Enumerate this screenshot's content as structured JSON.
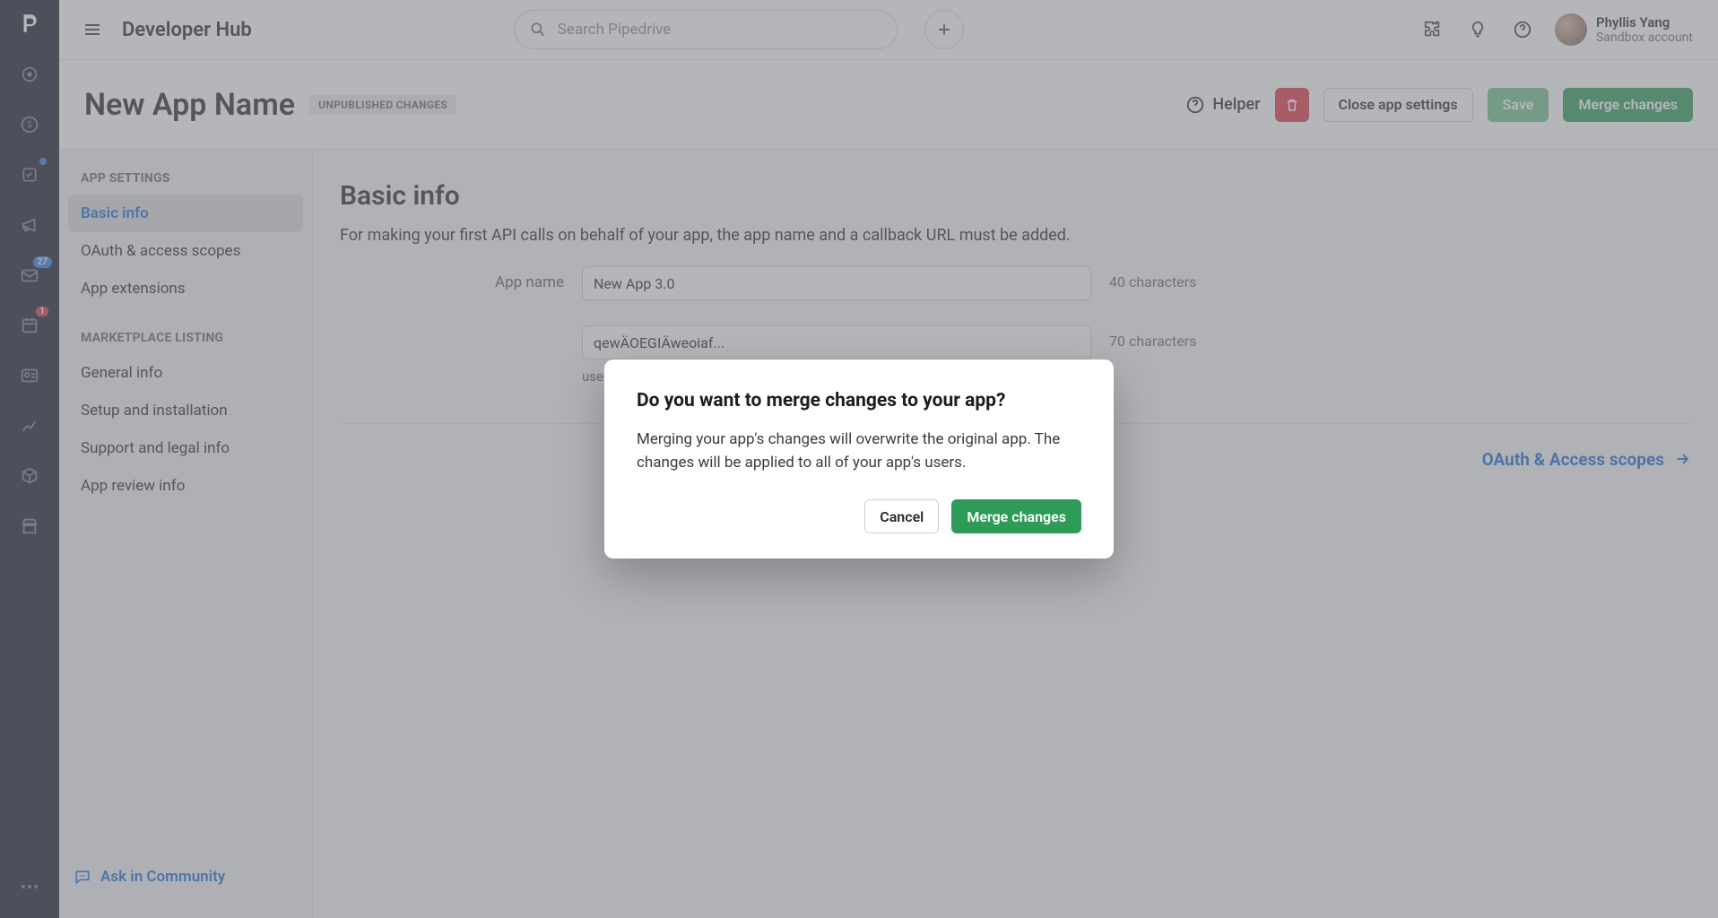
{
  "topbar": {
    "hub_title": "Developer Hub",
    "search_placeholder": "Search Pipedrive",
    "user_name": "Phyllis Yang",
    "user_acct": "Sandbox account"
  },
  "rail": {
    "badges": {
      "inbox_count": "27",
      "calendar_count": "1"
    }
  },
  "subheader": {
    "app_title": "New App Name",
    "chip": "UNPUBLISHED CHANGES",
    "helper_label": "Helper",
    "close_label": "Close app settings",
    "save_label": "Save",
    "merge_label": "Merge changes"
  },
  "sidebar": {
    "group1_label": "APP SETTINGS",
    "group1_items": [
      "Basic info",
      "OAuth & access scopes",
      "App extensions"
    ],
    "group2_label": "MARKETPLACE LISTING",
    "group2_items": [
      "General info",
      "Setup and installation",
      "Support and legal info",
      "App review info"
    ],
    "ask_label": "Ask in Community"
  },
  "main": {
    "section_title": "Basic info",
    "section_desc": "For making your first API calls on behalf of your app, the app name and a callback URL must be added.",
    "app_name_label": "App name",
    "app_name_value": "New App 3.0",
    "app_name_chars": "40 characters",
    "callback_value": "qewÄOEGIÄweoiaf...",
    "callback_chars": "70 characters",
    "callback_help": "users approve or decline  ...  successful",
    "next_link": "OAuth & Access scopes"
  },
  "modal": {
    "title": "Do you want to merge changes to your app?",
    "body": "Merging your app's changes will overwrite the original app. The changes will be applied to all of your app's users.",
    "cancel": "Cancel",
    "merge": "Merge changes"
  },
  "colors": {
    "primary_blue": "#1a6fd6",
    "green": "#2e9c58",
    "red": "#e0394b",
    "rail": "#1a1b2e"
  }
}
